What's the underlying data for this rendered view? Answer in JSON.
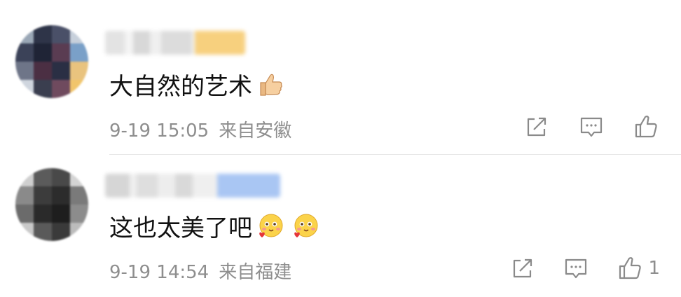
{
  "comments": [
    {
      "author_name": "",
      "text": "大自然的艺术",
      "time": "9-19 15:05",
      "location": "来自安徽",
      "emoji_icons": [
        "thumbs-up-emoji"
      ],
      "like_count": ""
    },
    {
      "author_name": "",
      "text": "这也太美了吧",
      "time": "9-19 14:54",
      "location": "来自福建",
      "emoji_icons": [
        "heart-face-emoji",
        "heart-face-emoji"
      ],
      "like_count": "1"
    }
  ],
  "icons": {
    "share": "share-icon",
    "reply": "comment-icon",
    "like": "like-icon"
  },
  "colors": {
    "text": "#111111",
    "secondary_text": "#8e8e8e",
    "icon": "#8a8a8a",
    "divider": "#e6e6e6"
  }
}
